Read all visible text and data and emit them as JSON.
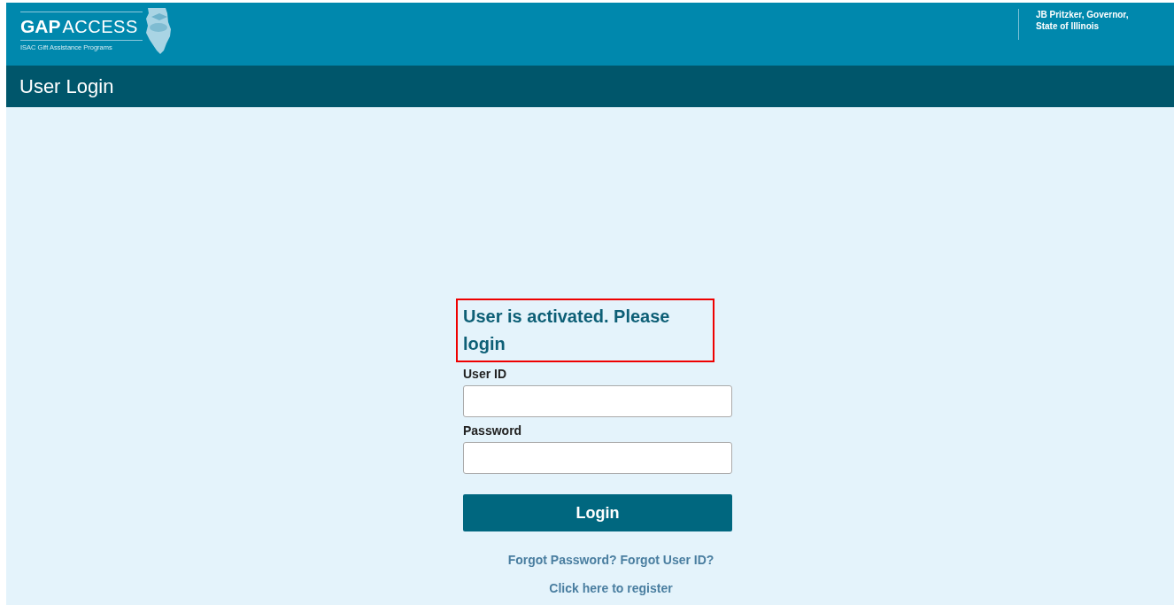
{
  "header": {
    "logo_bold": "GAP",
    "logo_light": "ACCESS",
    "logo_subtitle": "ISAC Gift Assistance Programs",
    "governor_lines": [
      "JB Pritzker, Governor,",
      "State of Illinois"
    ]
  },
  "page_title": "User Login",
  "message": "User is activated. Please login",
  "fields": [
    {
      "label": "User ID"
    },
    {
      "label": "Password"
    }
  ],
  "login_button": "Login",
  "links": [
    "Forgot Password?",
    "Forgot User ID?"
  ],
  "register_link": "Click here to register"
}
